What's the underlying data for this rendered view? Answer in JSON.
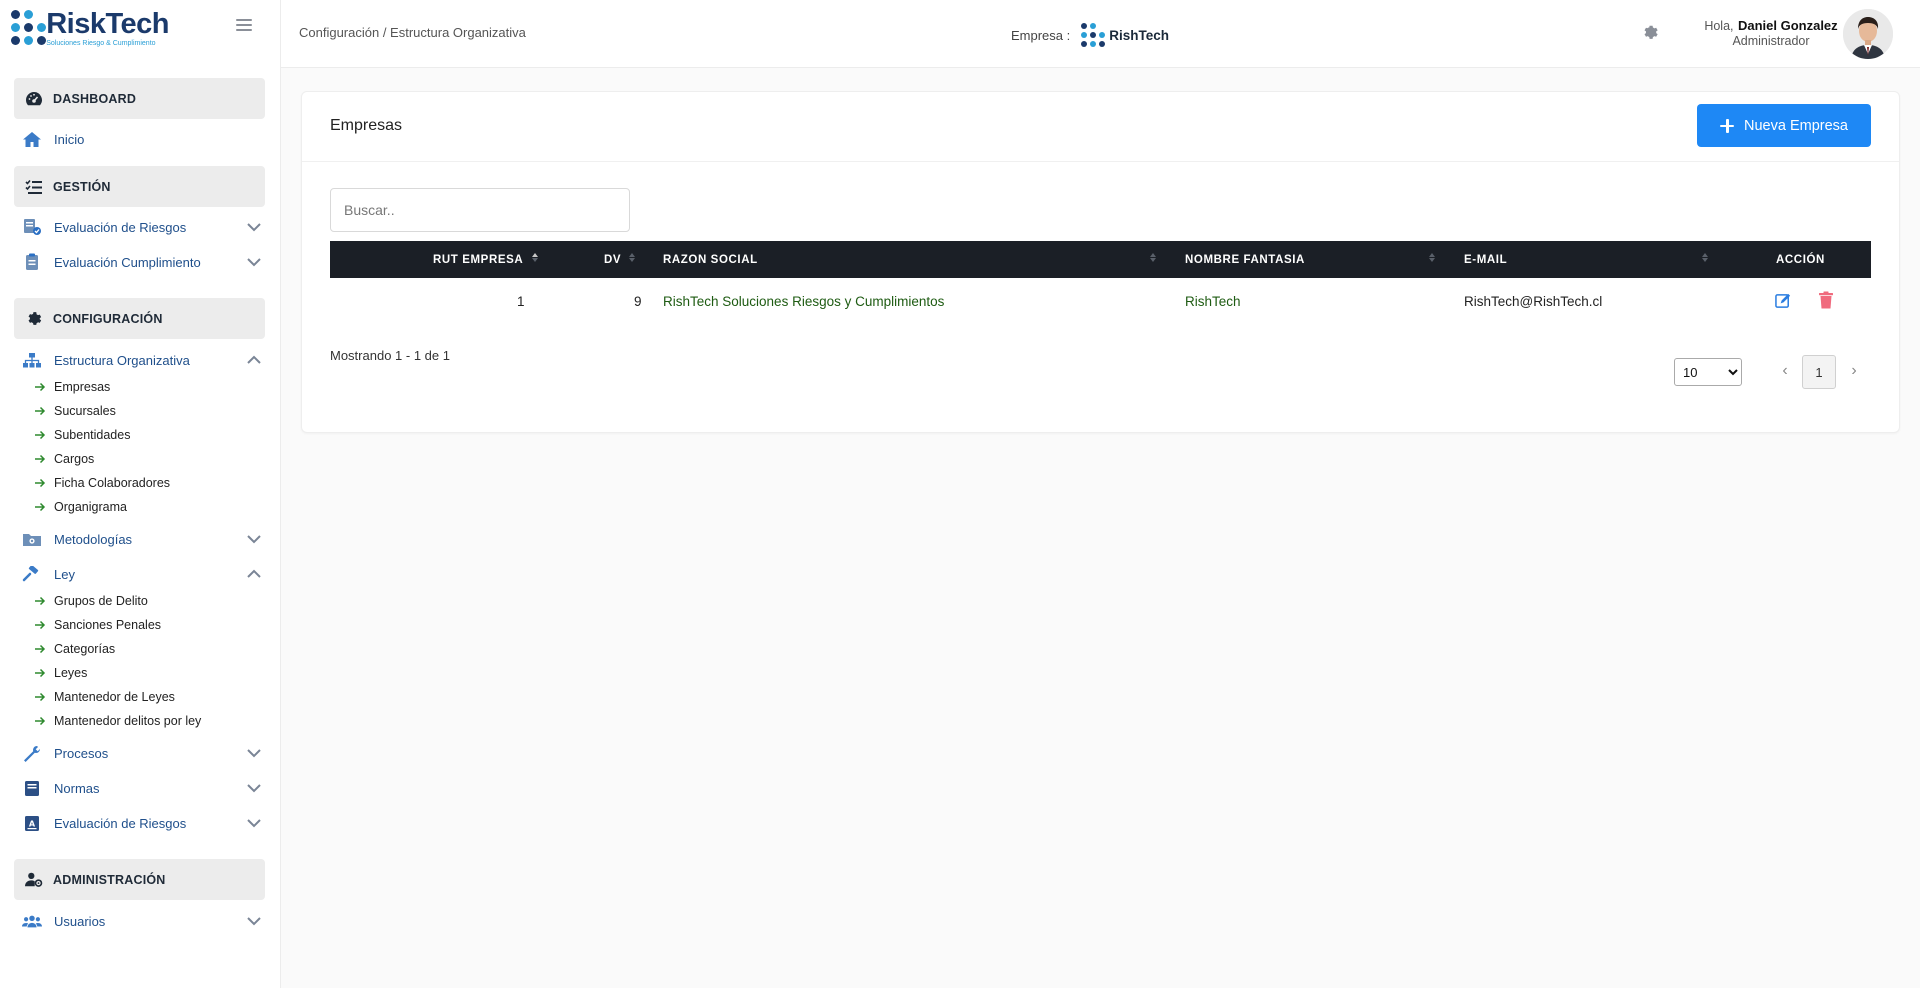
{
  "brand": {
    "name": "RiskTech",
    "tagline": "Soluciones Riesgo & Cumplimiento"
  },
  "colors": {
    "primary": "#1e88f5",
    "navy": "#1b3a6b",
    "accent_blue": "#2a9fd6",
    "link_green": "#1e5b12",
    "delete": "#f06b7e",
    "table_head": "#1b1f26"
  },
  "sidebar": {
    "sections": {
      "dashboard": {
        "label": "DASHBOARD",
        "icon": "speedometer-icon"
      },
      "gestion": {
        "label": "GESTIÓN",
        "icon": "checklist-icon"
      },
      "configuracion": {
        "label": "CONFIGURACIÓN",
        "icon": "gear-icon"
      },
      "administracion": {
        "label": "ADMINISTRACIÓN",
        "icon": "user-gear-icon"
      }
    },
    "items": {
      "inicio": "Inicio",
      "eval_riesgos": "Evaluación de Riesgos",
      "eval_cumplimiento": "Evaluación Cumplimiento",
      "estructura": "Estructura Organizativa",
      "metodologias": "Metodologías",
      "ley": "Ley",
      "procesos": "Procesos",
      "normas": "Normas",
      "eval_riesgos2": "Evaluación de Riesgos",
      "usuarios": "Usuarios"
    },
    "estructura_sub": [
      "Empresas",
      "Sucursales",
      "Subentidades",
      "Cargos",
      "Ficha Colaboradores",
      "Organigrama"
    ],
    "ley_sub": [
      "Grupos de Delito",
      "Sanciones Penales",
      "Categorías",
      "Leyes",
      "Mantenedor de Leyes",
      "Mantenedor delitos por ley"
    ]
  },
  "header": {
    "breadcrumb": "Configuración / Estructura Organizativa",
    "empresa_label": "Empresa :",
    "empresa_name": "RishTech",
    "greeting": "Hola,",
    "user_name": "Daniel Gonzalez",
    "user_role": "Administrador"
  },
  "main": {
    "title": "Empresas",
    "new_button": "Nueva Empresa",
    "search_placeholder": "Buscar..",
    "columns": [
      "RUT EMPRESA",
      "DV",
      "RAZON SOCIAL",
      "NOMBRE FANTASIA",
      "E-MAIL",
      "ACCIÓN"
    ],
    "rows": [
      {
        "rut": "1",
        "dv": "9",
        "razon": "RishTech Soluciones Riesgos y Cumplimientos",
        "fantasia": "RishTech",
        "email": "RishTech@RishTech.cl"
      }
    ],
    "showing": "Mostrando 1 - 1 de 1",
    "per_page": "10",
    "page": "1"
  }
}
